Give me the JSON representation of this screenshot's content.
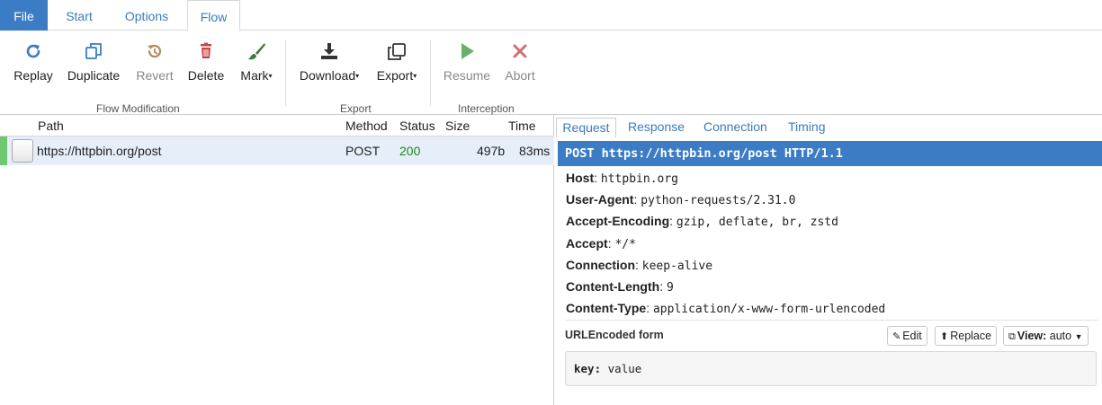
{
  "menu": {
    "tabs": [
      {
        "label": "File"
      },
      {
        "label": "Start"
      },
      {
        "label": "Options"
      },
      {
        "label": "Flow"
      }
    ]
  },
  "toolbar": {
    "groups": [
      {
        "label": "Flow Modification"
      },
      {
        "label": "Export"
      },
      {
        "label": "Interception"
      }
    ],
    "buttons": {
      "replay": {
        "label": "Replay",
        "icon": "replay-icon"
      },
      "duplicate": {
        "label": "Duplicate",
        "icon": "duplicate-icon"
      },
      "revert": {
        "label": "Revert",
        "icon": "revert-icon"
      },
      "delete": {
        "label": "Delete",
        "icon": "trash-icon"
      },
      "mark": {
        "label": "Mark",
        "icon": "paintbrush-icon"
      },
      "download": {
        "label": "Download",
        "icon": "download-icon"
      },
      "export": {
        "label": "Export",
        "icon": "clone-icon"
      },
      "resume": {
        "label": "Resume",
        "icon": "play-icon"
      },
      "abort": {
        "label": "Abort",
        "icon": "close-icon"
      }
    },
    "caret": "▾"
  },
  "flows": {
    "columns": [
      "Path",
      "Method",
      "Status",
      "Size",
      "Time"
    ],
    "rows": [
      {
        "path": "https://httpbin.org/post",
        "method": "POST",
        "status": "200",
        "size": "497b",
        "time": "83ms"
      }
    ]
  },
  "detail": {
    "tabs": [
      "Request",
      "Response",
      "Connection",
      "Timing"
    ],
    "request_line": "POST https://httpbin.org/post HTTP/1.1",
    "headers": [
      {
        "name": "Host",
        "value": "httpbin.org"
      },
      {
        "name": "User-Agent",
        "value": "python-requests/2.31.0"
      },
      {
        "name": "Accept-Encoding",
        "value": "gzip, deflate, br, zstd"
      },
      {
        "name": "Accept",
        "value": "*/*"
      },
      {
        "name": "Connection",
        "value": "keep-alive"
      },
      {
        "name": "Content-Length",
        "value": "9"
      },
      {
        "name": "Content-Type",
        "value": "application/x-www-form-urlencoded"
      }
    ],
    "separator": ":",
    "form": {
      "title": "URLEncoded form",
      "edit_label": "Edit",
      "replace_label": "Replace",
      "view_label": "View:",
      "view_value": "auto",
      "entries": [
        {
          "key": "key:",
          "value": "value"
        }
      ]
    }
  },
  "colors": {
    "accent": "#3b7cc5",
    "status_ok": "#1a8a1a",
    "mark": "#6ec86f",
    "selected_row": "#e6eefa"
  }
}
